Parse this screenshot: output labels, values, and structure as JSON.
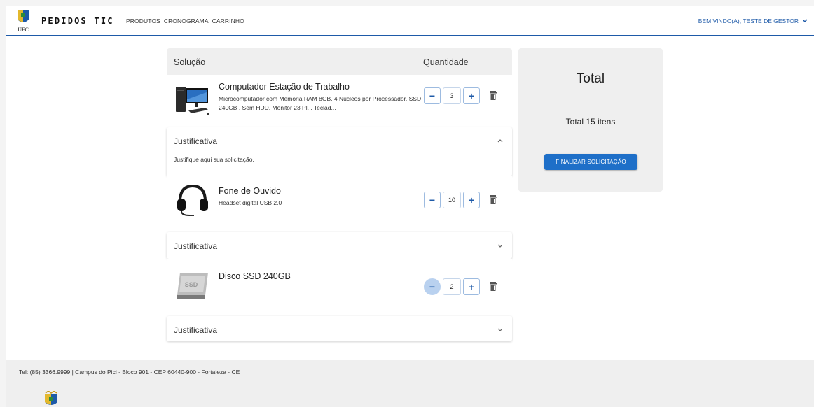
{
  "header": {
    "logo_text": "UFC",
    "brand": "PEDIDOS TIC",
    "nav": [
      "PRODUTOS",
      "CRONOGRAMA",
      "CARRINHO"
    ],
    "user_menu": "BEM VINDO(A), TESTE DE GESTOR"
  },
  "cart": {
    "col_solution": "Solução",
    "col_quantity": "Quantidade",
    "items": [
      {
        "title": "Computador Estação de Trabalho",
        "description": "Microcomputador com Memória RAM 8GB, 4 Núcleos por Processador, SSD 240GB , Sem HDD, Monitor 23 Pl. , Teclad...",
        "quantity": "3",
        "icon": "computer-image",
        "justification_label": "Justificativa",
        "justification_expanded": true,
        "justification_placeholder": "Justifique aqui sua solicitação."
      },
      {
        "title": "Fone de Ouvido",
        "description": "Headset digital USB 2.0",
        "quantity": "10",
        "icon": "headset-image",
        "justification_label": "Justificativa",
        "justification_expanded": false
      },
      {
        "title": "Disco SSD 240GB",
        "description": "",
        "quantity": "2",
        "icon": "ssd-image",
        "justification_label": "Justificativa",
        "justification_expanded": false
      }
    ]
  },
  "total": {
    "title": "Total",
    "items_text": "Total 15 itens",
    "finalize_label": "FINALIZAR SOLICITAÇÃO"
  },
  "footer": {
    "text": "Tel: (85) 3366.9999 | Campus do Pici - Bloco 901 - CEP 60440-900 - Fortaleza - CE"
  },
  "colors": {
    "accent": "#1e6fc8",
    "header_border": "#1e5aa8",
    "panel_bg": "#efefef"
  }
}
